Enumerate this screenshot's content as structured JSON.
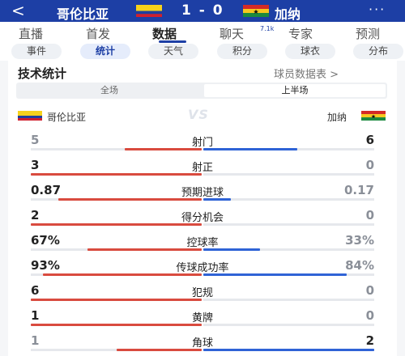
{
  "header": {
    "back_glyph": "<",
    "home_team": "哥伦比亚",
    "away_team": "加纳",
    "score": "1 - 0",
    "more_glyph": "···",
    "home_flag_icon": "colombia-flag-icon",
    "away_flag_icon": "ghana-flag-icon"
  },
  "tabs": [
    {
      "label": "直播",
      "active": false
    },
    {
      "label": "首发",
      "active": false
    },
    {
      "label": "数据",
      "active": true
    },
    {
      "label": "聊天",
      "active": false
    },
    {
      "label": "专家",
      "active": false
    },
    {
      "label": "预测",
      "active": false
    }
  ],
  "chat_badge": "7.1k",
  "subtabs": [
    {
      "label": "事件",
      "active": false
    },
    {
      "label": "统计",
      "active": true
    },
    {
      "label": "天气",
      "active": false
    },
    {
      "label": "积分",
      "active": false
    },
    {
      "label": "球衣",
      "active": false
    },
    {
      "label": "分布",
      "active": false
    }
  ],
  "section": {
    "title": "技术统计",
    "player_link": "球员数据表 >",
    "seg_full": "全场",
    "seg_half": "上半场",
    "vs": "VS"
  },
  "colors": {
    "brand_blue": "#1d3fa5",
    "home_bar": "#d94b3f",
    "away_bar": "#2f63d6",
    "track": "#e6e8ec",
    "winner_text": "#222222",
    "loser_text": "#8a8f98"
  },
  "stats": [
    {
      "label": "射门",
      "home": "5",
      "away": "6",
      "home_frac": 0.45,
      "away_frac": 0.55,
      "leader": "away"
    },
    {
      "label": "射正",
      "home": "3",
      "away": "0",
      "home_frac": 1.0,
      "away_frac": 0.0,
      "leader": "home"
    },
    {
      "label": "预期进球",
      "home": "0.87",
      "away": "0.17",
      "home_frac": 0.84,
      "away_frac": 0.16,
      "leader": "home"
    },
    {
      "label": "得分机会",
      "home": "2",
      "away": "0",
      "home_frac": 1.0,
      "away_frac": 0.0,
      "leader": "home"
    },
    {
      "label": "控球率",
      "home": "67%",
      "away": "33%",
      "home_frac": 0.67,
      "away_frac": 0.33,
      "leader": "home"
    },
    {
      "label": "传球成功率",
      "home": "93%",
      "away": "84%",
      "home_frac": 0.93,
      "away_frac": 0.84,
      "leader": "home"
    },
    {
      "label": "犯规",
      "home": "6",
      "away": "0",
      "home_frac": 1.0,
      "away_frac": 0.0,
      "leader": "home"
    },
    {
      "label": "黄牌",
      "home": "1",
      "away": "0",
      "home_frac": 1.0,
      "away_frac": 0.0,
      "leader": "home"
    },
    {
      "label": "角球",
      "home": "1",
      "away": "2",
      "home_frac": 0.5,
      "away_frac": 1.0,
      "leader": "away"
    }
  ]
}
